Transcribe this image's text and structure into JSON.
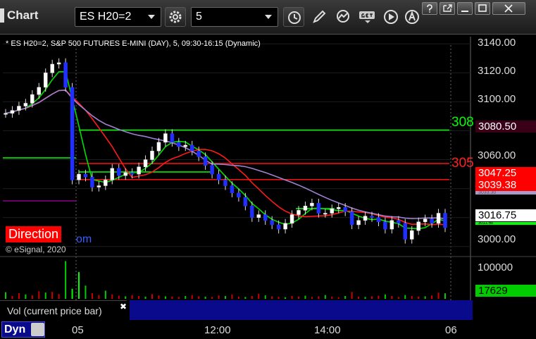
{
  "window": {
    "title": "Chart",
    "symbol": "ES H20=2",
    "interval": "5"
  },
  "chart": {
    "info_line": "* ES H20=2, S&P 500 FUTURES E-MINI (DAY), 5, 09:30-16:15 (Dynamic)",
    "copyright": "© eSignal, 2020",
    "direction_label": "Direction",
    "com_fragment": "om",
    "level_labels": [
      "308",
      "305"
    ],
    "price_tags": [
      {
        "label": "3080.50",
        "bg": "#3a0018",
        "fg": "#ffffff"
      },
      {
        "label": "3047.25",
        "bg": "#ff0000",
        "fg": "#ffffff"
      },
      {
        "label": "3039.38",
        "bg": "#ff0000",
        "fg": "#ffffff"
      },
      {
        "label": "3033.30",
        "bg": "#a89ac8",
        "fg": "#555555"
      },
      {
        "label": "3016.75",
        "bg": "#ffffff",
        "fg": "#000000"
      },
      {
        "label": "3011.50",
        "bg": "#00ff00",
        "fg": "#000000"
      }
    ]
  },
  "chart_data": [
    {
      "type": "line",
      "title": "",
      "ylabels": [
        "3140.00",
        "3120.00",
        "3100.00",
        "3080.00",
        "3060.00",
        "3040.00",
        "3000.00"
      ],
      "ylim": [
        2995,
        3145
      ],
      "xlabels": [
        "05",
        "12:00",
        "14:00",
        "06"
      ],
      "levels": [
        3080.5,
        3055.0,
        3047.25,
        3039.38
      ],
      "series": [
        {
          "values": [
            3092,
            3094,
            3097,
            3099,
            3105,
            3110,
            3120,
            3126,
            3127,
            3110,
            3046,
            3050,
            3048,
            3041,
            3042,
            3046,
            3054,
            3049,
            3051,
            3050,
            3055,
            3060,
            3066,
            3072,
            3078,
            3072,
            3069,
            3070,
            3066,
            3062,
            3056,
            3050,
            3046,
            3042,
            3037,
            3034,
            3028,
            3020,
            3022,
            3018,
            3015,
            3012,
            3016,
            3022,
            3025,
            3028,
            3030,
            3023,
            3023,
            3026,
            3027,
            3024,
            3015,
            3018,
            3021,
            3020,
            3017,
            3012,
            3018,
            3016,
            3005,
            3011,
            3017,
            3019,
            3016,
            3023,
            3013
          ]
        }
      ]
    },
    {
      "type": "bar",
      "title": "Vol (current price bar)",
      "ylabels": [
        "100000",
        "17629"
      ],
      "ylim": [
        0,
        130000
      ],
      "values": [
        21000,
        9000,
        18000,
        14000,
        11000,
        24000,
        20000,
        22000,
        15000,
        120000,
        32000,
        85000,
        42000,
        18000,
        12000,
        26000,
        14000,
        10000,
        8000,
        12000,
        9000,
        7000,
        15000,
        11000,
        8000,
        7000,
        6000,
        9000,
        12000,
        8000,
        7000,
        6000,
        11000,
        9000,
        14000,
        7000,
        6000,
        9000,
        16000,
        11000,
        8000,
        6000,
        5000,
        9000,
        7000,
        10000,
        6000,
        8000,
        12000,
        7000,
        5000,
        9000,
        22000,
        7000,
        6000,
        8000,
        10000,
        14000,
        9000,
        6000,
        12000,
        9000,
        7000,
        8000,
        11000,
        20000,
        17629
      ]
    }
  ]
}
